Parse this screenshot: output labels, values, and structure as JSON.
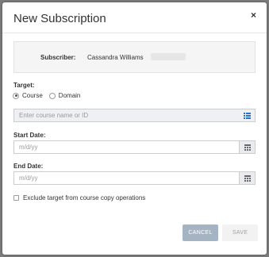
{
  "modal": {
    "title": "New Subscription",
    "close_glyph": "×"
  },
  "subscriber": {
    "label": "Subscriber:",
    "name": "Cassandra Williams"
  },
  "target": {
    "label": "Target:",
    "options": [
      "Course",
      "Domain"
    ],
    "selected": "Course",
    "input_placeholder": "Enter course name or ID",
    "input_icon": "list-icon"
  },
  "start_date": {
    "label": "Start Date:",
    "placeholder": "m/d/yy",
    "icon": "calendar-icon"
  },
  "end_date": {
    "label": "End Date:",
    "placeholder": "m/d/yy",
    "icon": "calendar-icon"
  },
  "exclude": {
    "label": "Exclude target from course copy operations",
    "checked": false
  },
  "buttons": {
    "cancel": "CANCEL",
    "save": "SAVE"
  },
  "colors": {
    "accent_icon": "#2a73c9",
    "cancel_bg": "#a5b4c3",
    "save_bg": "#f2f2f2"
  }
}
